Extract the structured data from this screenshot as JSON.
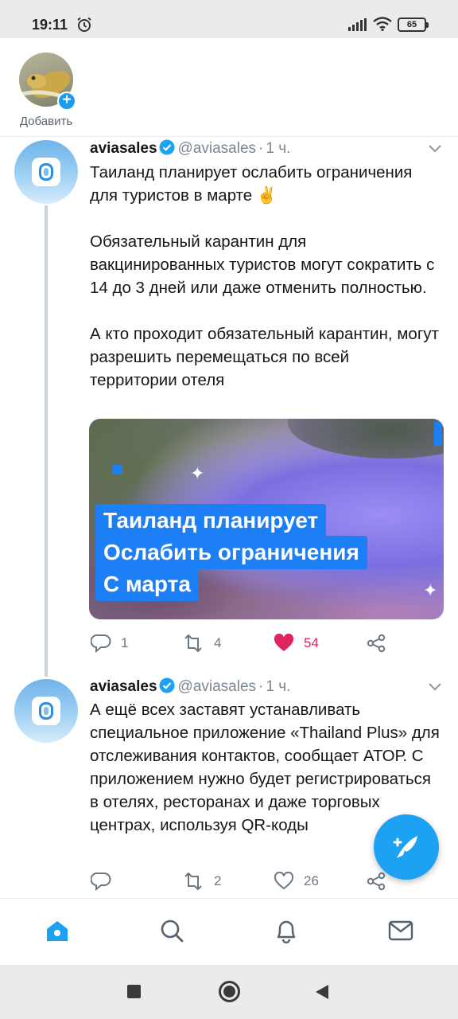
{
  "status_bar": {
    "time": "19:11",
    "battery": "65",
    "icons": [
      "alarm-icon",
      "signal-icon",
      "wifi-icon",
      "battery-icon"
    ]
  },
  "fleets": {
    "add_label": "Добавить"
  },
  "tweets": [
    {
      "name": "aviasales",
      "handle": "@aviasales",
      "separator": "·",
      "time": "1 ч.",
      "text": [
        "Таиланд планирует ослабить ограничения для туристов в марте ✌️",
        "Обязательный карантин для вакцинированных туристов могут сократить с 14 до 3 дней или даже отменить полностью.",
        "А кто проходит обязательный карантин, могут разрешить перемещаться по всей территории отеля"
      ],
      "media_lines": [
        "Таиланд планирует",
        "Ослабить ограничения",
        "С марта"
      ],
      "replies": "1",
      "retweets": "4",
      "likes": "54",
      "liked": true
    },
    {
      "name": "aviasales",
      "handle": "@aviasales",
      "separator": "·",
      "time": "1 ч.",
      "text": [
        "А ещё всех заставят устанавливать специальное приложение «Thailand Plus» для отслеживания контактов, сообщает АТОР. С приложением нужно будет регистрироваться в отелях, ресторанах и даже торговых центрах, используя QR-коды"
      ],
      "replies": "",
      "retweets": "2",
      "likes": "26",
      "liked": false
    }
  ],
  "colors": {
    "accent": "#1da1f2",
    "like_red": "#e0245e",
    "media_banner": "#1d7ff5"
  },
  "bottom_nav": [
    "home-icon",
    "search-icon",
    "notifications-icon",
    "messages-icon"
  ]
}
